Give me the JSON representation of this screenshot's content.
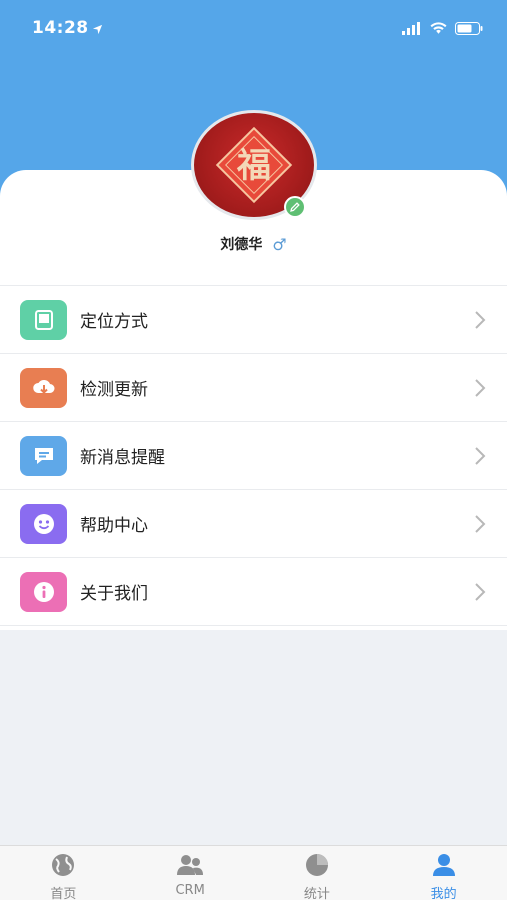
{
  "status_bar": {
    "time": "14:28"
  },
  "profile": {
    "name": "刘德华",
    "gender_symbol": "♂",
    "avatar_glyph": "福"
  },
  "menu": [
    {
      "label": "定位方式",
      "icon": "tablet-icon",
      "color": "#5fd0a6"
    },
    {
      "label": "检测更新",
      "icon": "cloud-download-icon",
      "color": "#e87e52"
    },
    {
      "label": "新消息提醒",
      "icon": "message-icon",
      "color": "#5fa8e8"
    },
    {
      "label": "帮助中心",
      "icon": "smile-icon",
      "color": "#8a6cf0"
    },
    {
      "label": "关于我们",
      "icon": "info-icon",
      "color": "#ec6fb5"
    }
  ],
  "tabbar": [
    {
      "label": "首页",
      "icon": "globe-icon",
      "active": false
    },
    {
      "label": "CRM",
      "icon": "users-icon",
      "active": false
    },
    {
      "label": "统计",
      "icon": "pie-chart-icon",
      "active": false
    },
    {
      "label": "我的",
      "icon": "user-icon",
      "active": true
    }
  ],
  "colors": {
    "header": "#55a6e9",
    "active_tab": "#3a8ee6"
  }
}
